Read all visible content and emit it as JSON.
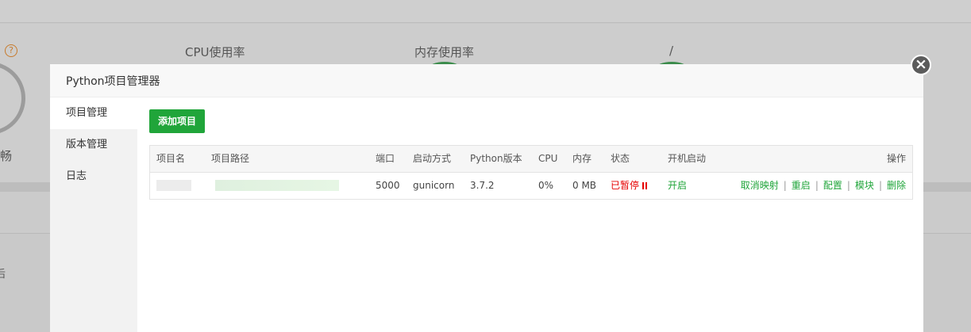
{
  "background": {
    "labels": {
      "cpu": "CPU使用率",
      "memory": "内存使用率",
      "disk": "/",
      "left_text": "畅",
      "left_text2": "后"
    }
  },
  "modal": {
    "title": "Python项目管理器",
    "close_icon": "close-icon"
  },
  "sidebar": {
    "items": [
      {
        "label": "项目管理",
        "active": true
      },
      {
        "label": "版本管理",
        "active": false
      },
      {
        "label": "日志",
        "active": false
      }
    ]
  },
  "toolbar": {
    "add_label": "添加项目"
  },
  "table": {
    "headers": {
      "name": "项目名",
      "path": "项目路径",
      "port": "端口",
      "start_mode": "启动方式",
      "python_version": "Python版本",
      "cpu": "CPU",
      "memory": "内存",
      "status": "状态",
      "autostart": "开机启动",
      "actions": "操作"
    },
    "rows": [
      {
        "port": "5000",
        "start_mode": "gunicorn",
        "python_version": "3.7.2",
        "cpu": "0%",
        "memory": "0 MB",
        "status": "已暂停",
        "autostart": "开启",
        "actions": [
          "取消映射",
          "重启",
          "配置",
          "模块",
          "删除"
        ]
      }
    ]
  },
  "colors": {
    "accent": "#20a53a",
    "danger": "#e60000"
  }
}
